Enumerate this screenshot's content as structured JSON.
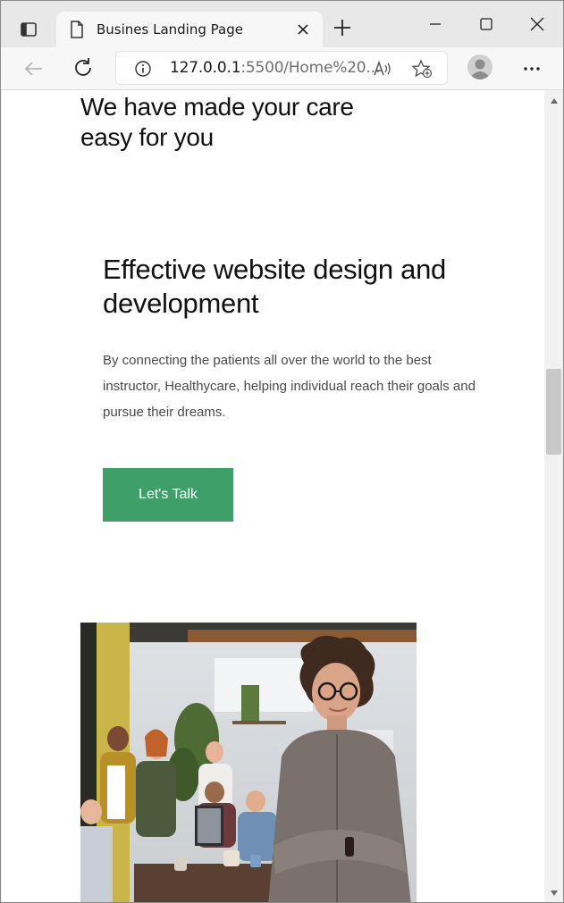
{
  "browser": {
    "tab_title": "Busines Landing Page",
    "url_host": "127.0.0.1",
    "url_rest": ":5500/Home%20..."
  },
  "page": {
    "heading": "We have made your care easy for you",
    "card_title": "Effective website design and development",
    "card_text": "By connecting the patients all over the world to the best instructor, Healthycare, helping individual reach their goals and pursue their dreams.",
    "cta_label": "Let's Talk"
  },
  "colors": {
    "accent": "#3f9f69",
    "heading": "#111111",
    "body_text": "#4a4a4a"
  },
  "icons": [
    "sidebar-toggle-icon",
    "page-icon",
    "close-icon",
    "plus-icon",
    "minimize-icon",
    "maximize-icon",
    "back-arrow-icon",
    "reload-icon",
    "info-icon",
    "read-aloud-icon",
    "add-favorite-icon",
    "profile-icon",
    "more-icon"
  ]
}
